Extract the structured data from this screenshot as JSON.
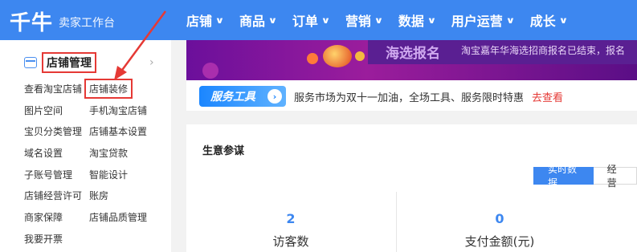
{
  "header": {
    "logo": "千牛",
    "subtitle": "卖家工作台",
    "nav": [
      {
        "label": "店铺",
        "icon": "chevron-down-icon"
      },
      {
        "label": "商品",
        "icon": "chevron-down-icon"
      },
      {
        "label": "订单",
        "icon": "chevron-down-icon"
      },
      {
        "label": "营销",
        "icon": "chevron-down-icon"
      },
      {
        "label": "数据",
        "icon": "chevron-down-icon"
      },
      {
        "label": "用户运营",
        "icon": "chevron-down-icon"
      },
      {
        "label": "成长",
        "icon": "chevron-down-icon"
      }
    ]
  },
  "sidebar": {
    "title": "店铺管理",
    "rows": [
      [
        "查看淘宝店铺",
        "店铺装修"
      ],
      [
        "图片空间",
        "手机淘宝店铺"
      ],
      [
        "宝贝分类管理",
        "店铺基本设置"
      ],
      [
        "域名设置",
        "淘宝贷款"
      ],
      [
        "子账号管理",
        "智能设计"
      ],
      [
        "店铺经营许可",
        "账房"
      ],
      [
        "商家保障",
        "店铺品质管理"
      ],
      [
        "我要开票",
        ""
      ]
    ]
  },
  "banner": {
    "title": "海选报名",
    "text": "淘宝嘉年华海选招商报名已结束，报名"
  },
  "service": {
    "badge": "服务工具",
    "text": "服务市场为双十一加油，全场工具、服务限时特惠",
    "link": "去查看"
  },
  "card": {
    "title": "生意参谋",
    "tabs": [
      "实时数据",
      "经营"
    ],
    "stats": [
      {
        "value": "2",
        "label": "访客数"
      },
      {
        "value": "0",
        "label": "支付金额(元)"
      }
    ]
  },
  "colors": {
    "brand": "#3d87f0",
    "highlight": "#e53935"
  }
}
